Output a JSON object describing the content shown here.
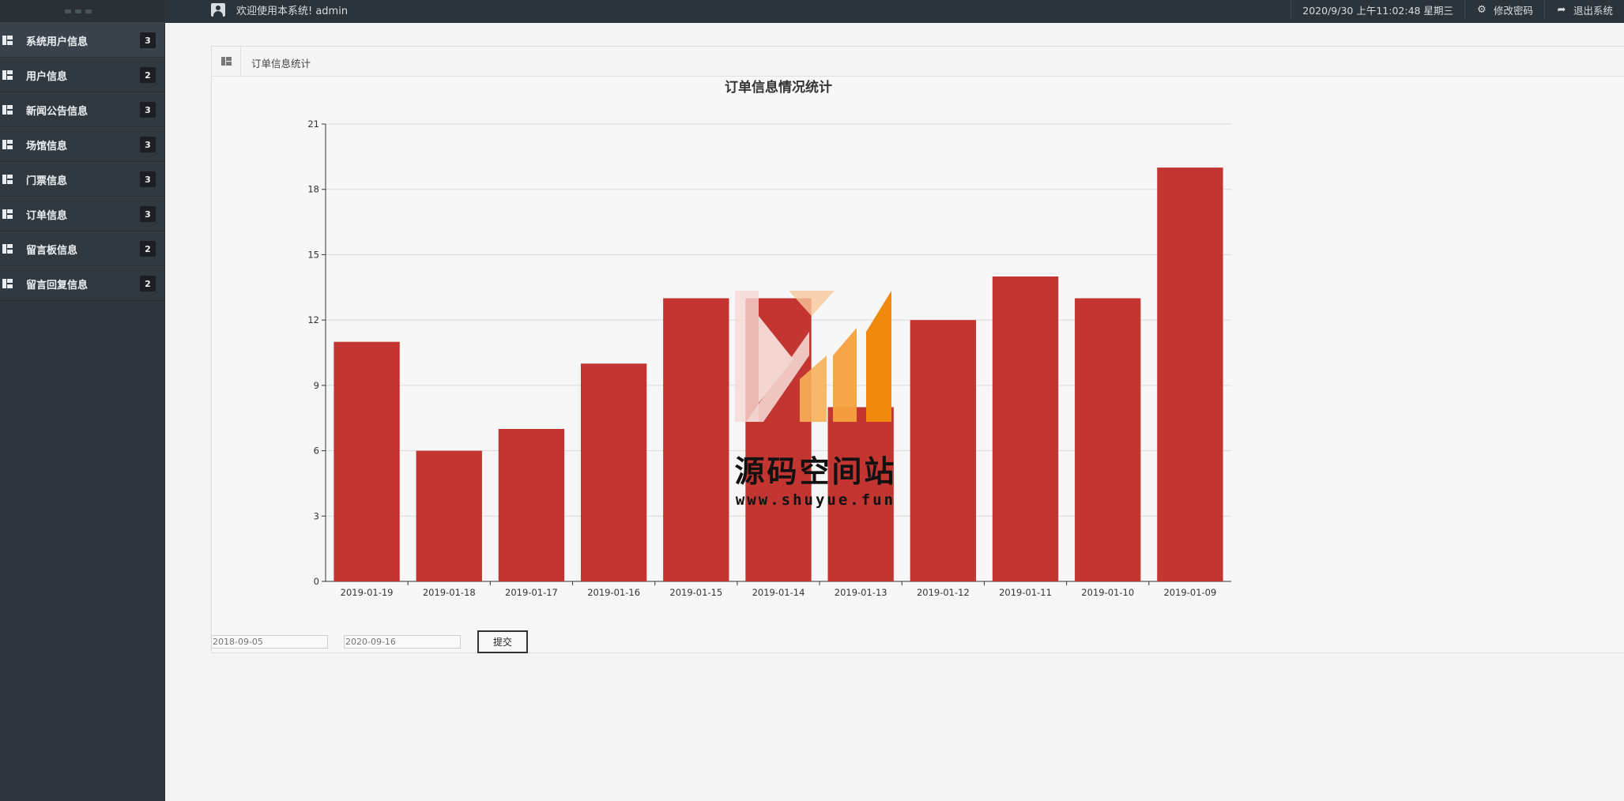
{
  "header": {
    "welcome": "欢迎使用本系统! admin",
    "datetime": "2020/9/30 上午11:02:48 星期三",
    "change_password": "修改密码",
    "logout": "退出系统"
  },
  "sidebar": {
    "items": [
      {
        "label": "系统用户信息",
        "count": "3"
      },
      {
        "label": "用户信息",
        "count": "2"
      },
      {
        "label": "新闻公告信息",
        "count": "3"
      },
      {
        "label": "场馆信息",
        "count": "3"
      },
      {
        "label": "门票信息",
        "count": "3"
      },
      {
        "label": "订单信息",
        "count": "3"
      },
      {
        "label": "留言板信息",
        "count": "2"
      },
      {
        "label": "留言回复信息",
        "count": "2"
      }
    ]
  },
  "panel": {
    "title": "订单信息统计"
  },
  "chart_data": {
    "type": "bar",
    "title": "订单信息情况统计",
    "categories": [
      "2019-01-19",
      "2019-01-18",
      "2019-01-17",
      "2019-01-16",
      "2019-01-15",
      "2019-01-14",
      "2019-01-13",
      "2019-01-12",
      "2019-01-11",
      "2019-01-10",
      "2019-01-09"
    ],
    "values": [
      11,
      6,
      7,
      10,
      13,
      13,
      8,
      12,
      14,
      13,
      19
    ],
    "yticks": [
      0,
      3,
      6,
      9,
      12,
      15,
      18,
      21
    ],
    "ylim": [
      0,
      21
    ],
    "grid": true,
    "color": "#c23531"
  },
  "watermark": {
    "text": "源码空间站",
    "url": "www.shuyue.fun"
  },
  "form": {
    "start_date": "2018-09-05",
    "end_date": "2020-09-16",
    "submit_label": "提交"
  }
}
